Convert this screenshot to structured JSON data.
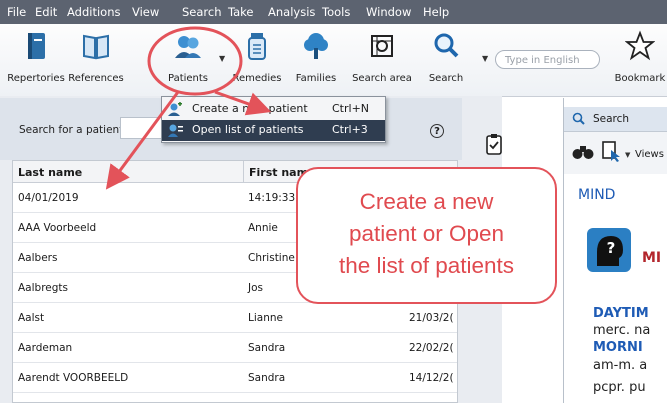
{
  "menubar": {
    "items": [
      "File",
      "Edit",
      "Additions",
      "View",
      "Search",
      "Take",
      "Analysis",
      "Tools",
      "Window",
      "Help"
    ]
  },
  "toolbar": {
    "buttons": [
      {
        "label": "Repertories",
        "icon": "book-icon"
      },
      {
        "label": "References",
        "icon": "open-book-icon"
      },
      {
        "label": "Patients",
        "icon": "patients-icon"
      },
      {
        "label": "Remedies",
        "icon": "remedy-jar-icon"
      },
      {
        "label": "Families",
        "icon": "tree-icon"
      },
      {
        "label": "Search area",
        "icon": "search-area-icon"
      },
      {
        "label": "Search",
        "icon": "magnifier-icon"
      },
      {
        "label": "Bookmark",
        "icon": "star-icon"
      }
    ],
    "type_placeholder": "Type in English"
  },
  "patients_menu": {
    "items": [
      {
        "label": "Create a new patient",
        "shortcut": "Ctrl+N"
      },
      {
        "label": "Open list of patients",
        "shortcut": "Ctrl+3"
      }
    ]
  },
  "left_panel": {
    "search_label": "Search for a patient:",
    "columns": [
      "Last name",
      "First name"
    ],
    "rows": [
      {
        "last": "04/01/2019",
        "first": "14:19:33",
        "date": ""
      },
      {
        "last": "AAA Voorbeeld",
        "first": "Annie",
        "date": ""
      },
      {
        "last": "Aalbers",
        "first": "Christine",
        "date": ""
      },
      {
        "last": "Aalbregts",
        "first": "Jos",
        "date": ""
      },
      {
        "last": "Aalst",
        "first": "Lianne",
        "date": "21/03/2("
      },
      {
        "last": "Aardeman",
        "first": "Sandra",
        "date": "22/02/2("
      },
      {
        "last": "Aarendt VOORBEELD",
        "first": "Sandra",
        "date": "14/12/2("
      }
    ]
  },
  "right_panel": {
    "tab_label": "Search",
    "views_label": "Views",
    "heading": "MIND",
    "side_letters": "MI",
    "lines": [
      {
        "text": "DAYTIM",
        "style": "bold-blue"
      },
      {
        "text": "merc. na",
        "style": "normal"
      },
      {
        "text": "MORNI",
        "style": "bold-blue"
      },
      {
        "text": "am-m. a",
        "style": "normal"
      },
      {
        "text": "pcpr. pu",
        "style": "normal"
      }
    ]
  },
  "callout": {
    "lines": [
      "Create a new",
      "patient or Open",
      "the list of patients"
    ]
  },
  "colors": {
    "accent_red": "#e3535a",
    "menubar": "#5c6370",
    "highlight": "#2f3d50",
    "link_blue": "#1e5bb5"
  }
}
